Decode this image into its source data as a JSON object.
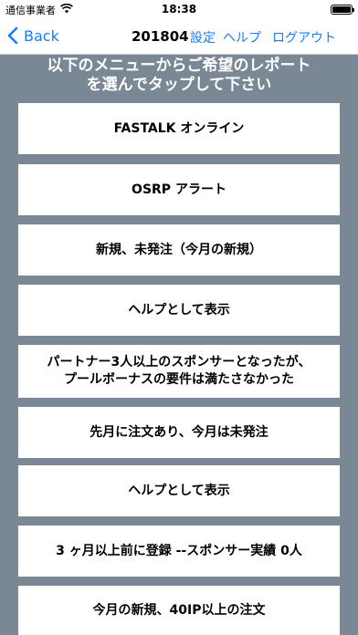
{
  "status_bar": {
    "carrier": "通信事業者",
    "time": "18:38",
    "battery_level": 1.0
  },
  "nav": {
    "back_label": "Back",
    "title": "201804",
    "settings_label": "設定",
    "help_label": "ヘルプ",
    "logout_label": "ログアウト"
  },
  "instruction": {
    "line1": "以下のメニューからご希望のレポート",
    "line2": "を選んでタップして下さい"
  },
  "menu": [
    {
      "label": "FASTALK オンライン"
    },
    {
      "label": "OSRP アラート"
    },
    {
      "label": "新規、未発注（今月の新規）"
    },
    {
      "label": "ヘルプとして表示"
    },
    {
      "line1": "パートナー3人以上のスポンサーとなったが、",
      "line2": "プールボーナスの要件は満たさなかった"
    },
    {
      "label": "先月に注文あり、今月は未発注"
    },
    {
      "label": "ヘルプとして表示"
    },
    {
      "label": "3 ヶ月以上前に登録 --スポンサー実績 0人"
    },
    {
      "label": "今月の新規、40IP以上の注文"
    }
  ],
  "colors": {
    "background": "#7a8795",
    "accent": "#1b7cf6",
    "button": "#ffffff"
  }
}
